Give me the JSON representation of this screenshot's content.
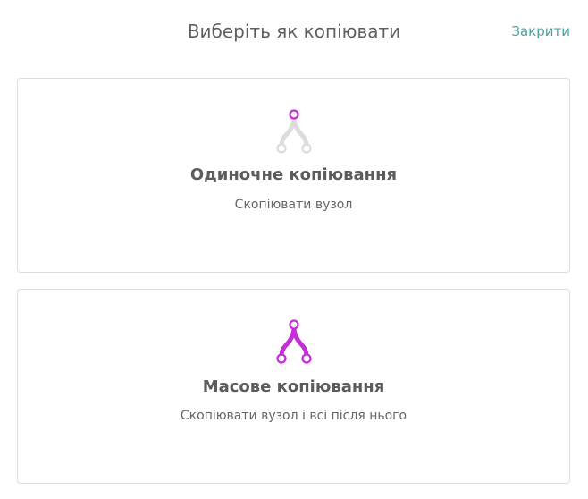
{
  "dialog": {
    "title": "Виберіть як копіювати",
    "close_label": "Закрити"
  },
  "options": [
    {
      "title": "Одиночне копіювання",
      "description": "Скопіювати вузол",
      "icon": "single-copy-node-icon"
    },
    {
      "title": "Масове копіювання",
      "description": "Скопіювати вузол і всі після нього",
      "icon": "bulk-copy-node-icon"
    }
  ],
  "colors": {
    "accent": "#c42fd8",
    "link": "#4aa3a3",
    "inactive_branch": "#dcdcdc",
    "border": "#dedede"
  }
}
